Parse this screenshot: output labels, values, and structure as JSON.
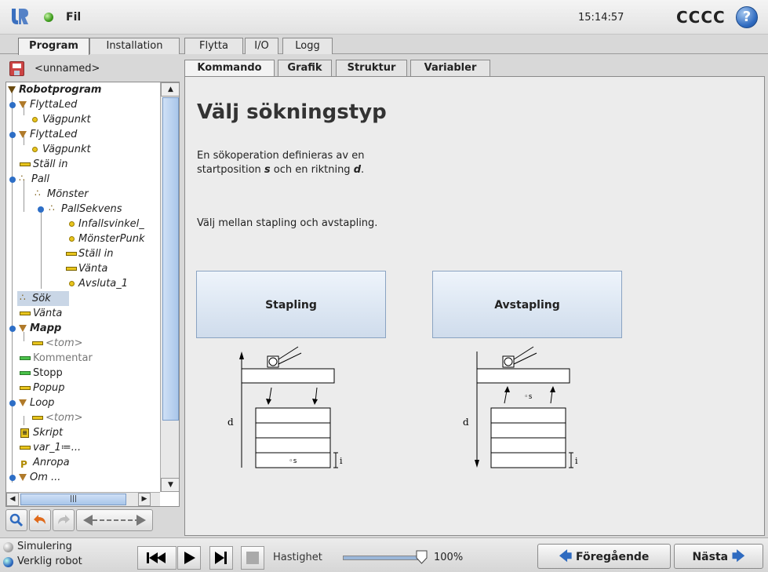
{
  "topbar": {
    "file_label": "Fil",
    "clock": "15:14:57",
    "robot_name": "CCCC",
    "help_glyph": "?"
  },
  "main_tabs": [
    {
      "label": "Program",
      "active": true
    },
    {
      "label": "Installation",
      "active": false
    },
    {
      "label": "Flytta",
      "active": false
    },
    {
      "label": "I/O",
      "active": false
    },
    {
      "label": "Logg",
      "active": false
    }
  ],
  "program_file": {
    "name": "<unnamed>"
  },
  "tree": [
    {
      "label": "Robotprogram",
      "style": "bold-italic",
      "icon": "collapse-triangle"
    },
    {
      "label": "FlyttaLed",
      "style": "italic",
      "icon": "move-triangle"
    },
    {
      "label": "Vägpunkt",
      "style": "italic",
      "icon": "waypoint-dot"
    },
    {
      "label": "FlyttaLed",
      "style": "italic",
      "icon": "move-triangle"
    },
    {
      "label": "Vägpunkt",
      "style": "italic",
      "icon": "waypoint-dot"
    },
    {
      "label": "Ställ in",
      "style": "italic",
      "icon": "set-bar"
    },
    {
      "label": "Pall",
      "style": "italic",
      "icon": "pallet-dots"
    },
    {
      "label": "Mönster",
      "style": "italic",
      "icon": "pallet-dots"
    },
    {
      "label": "PallSekvens",
      "style": "italic",
      "icon": "pallet-dots"
    },
    {
      "label": "Infallsvinkel_",
      "style": "italic",
      "icon": "waypoint-dot"
    },
    {
      "label": "MönsterPunk",
      "style": "italic",
      "icon": "waypoint-dot"
    },
    {
      "label": "Ställ in",
      "style": "italic",
      "icon": "set-bar"
    },
    {
      "label": "Vänta",
      "style": "italic",
      "icon": "set-bar"
    },
    {
      "label": "Avsluta_1",
      "style": "italic",
      "icon": "waypoint-dot"
    },
    {
      "label": "Sök",
      "style": "italic",
      "icon": "pallet-dots"
    },
    {
      "label": "Vänta",
      "style": "italic",
      "icon": "set-bar"
    },
    {
      "label": "Mapp",
      "style": "bold-italic",
      "icon": "collapse-triangle"
    },
    {
      "label": "<tom>",
      "style": "italic-gray",
      "icon": "set-bar"
    },
    {
      "label": "Kommentar",
      "style": "gray",
      "icon": "comment-bar"
    },
    {
      "label": "Stopp",
      "style": "normal",
      "icon": "stop-bar"
    },
    {
      "label": "Popup",
      "style": "italic",
      "icon": "set-bar"
    },
    {
      "label": "Loop",
      "style": "italic",
      "icon": "collapse-triangle"
    },
    {
      "label": "<tom>",
      "style": "italic-gray",
      "icon": "set-bar"
    },
    {
      "label": "Skript",
      "style": "italic",
      "icon": "script-square"
    },
    {
      "label": "var_1≔...",
      "style": "italic",
      "icon": "set-bar"
    },
    {
      "label": "Anropa",
      "style": "italic",
      "icon": "call-flag"
    },
    {
      "label": "Om ...",
      "style": "italic",
      "icon": "collapse-triangle"
    }
  ],
  "tree_tools": {
    "search": "search-icon",
    "undo": "undo-icon",
    "redo": "redo-icon",
    "move": "move-arrows-icon"
  },
  "sub_tabs": [
    {
      "label": "Kommando",
      "active": true
    },
    {
      "label": "Grafik",
      "active": false
    },
    {
      "label": "Struktur",
      "active": false
    },
    {
      "label": "Variabler",
      "active": false
    }
  ],
  "panel": {
    "title": "Välj sökningstyp",
    "desc_line1": "En sökoperation definieras av en",
    "desc_line2a": "startposition ",
    "desc_s": "s",
    "desc_line2b": " och en riktning ",
    "desc_d": "d",
    "desc_line2c": ".",
    "choose_text": "Välj mellan stapling och avstapling.",
    "stack_button": "Stapling",
    "unstack_button": "Avstapling",
    "diagram_d": "d",
    "diagram_s": "◦s",
    "diagram_i": "i"
  },
  "bottom": {
    "mode_simulation": "Simulering",
    "mode_real": "Verklig robot",
    "speed_label": "Hastighet",
    "speed_value": "100%",
    "speed_level": 1.0,
    "prev_label": "Föregående",
    "next_label": "Nästa"
  },
  "colors": {
    "accent_blue": "#2f6bc0",
    "tree_icon_yellow": "#e8c51e",
    "button_blue": "#cfdcec"
  }
}
